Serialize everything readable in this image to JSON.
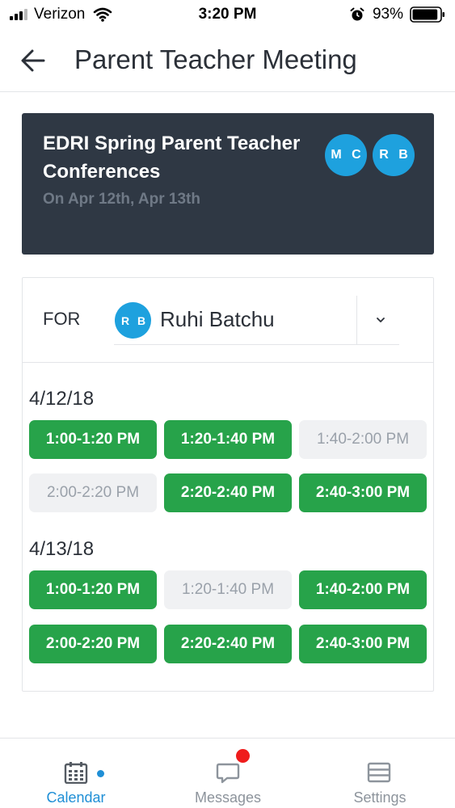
{
  "status_bar": {
    "carrier": "Verizon",
    "time": "3:20 PM",
    "battery": "93%",
    "battery_level": 0.93
  },
  "header": {
    "title": "Parent Teacher Meeting",
    "back_icon": "back-arrow-icon"
  },
  "event": {
    "title": "EDRI Spring Parent Teacher Conferences",
    "dates": "On Apr 12th, Apr 13th",
    "participants": [
      "M C",
      "R B"
    ],
    "colors": {
      "card_bg": "#2f3844",
      "avatar": "#1ea1de"
    }
  },
  "booking": {
    "for_label": "FOR",
    "student": {
      "initials": "R B",
      "name": "Ruhi Batchu"
    },
    "days": [
      {
        "date": "4/12/18",
        "slots": [
          {
            "time": "1:00-1:20 PM",
            "available": true
          },
          {
            "time": "1:20-1:40 PM",
            "available": true
          },
          {
            "time": "1:40-2:00 PM",
            "available": false
          },
          {
            "time": "2:00-2:20 PM",
            "available": false
          },
          {
            "time": "2:20-2:40 PM",
            "available": true
          },
          {
            "time": "2:40-3:00 PM",
            "available": true
          }
        ]
      },
      {
        "date": "4/13/18",
        "slots": [
          {
            "time": "1:00-1:20 PM",
            "available": true
          },
          {
            "time": "1:20-1:40 PM",
            "available": false
          },
          {
            "time": "1:40-2:00 PM",
            "available": true
          },
          {
            "time": "2:00-2:20 PM",
            "available": true
          },
          {
            "time": "2:20-2:40 PM",
            "available": true
          },
          {
            "time": "2:40-3:00 PM",
            "available": true
          }
        ]
      }
    ],
    "colors": {
      "available": "#27a34a",
      "unavailable": "#f0f1f3"
    }
  },
  "tabs": [
    {
      "label": "Calendar",
      "icon": "calendar-icon",
      "active": true
    },
    {
      "label": "Messages",
      "icon": "chat-bubble-icon",
      "active": false,
      "has_notification": true
    },
    {
      "label": "Settings",
      "icon": "settings-list-icon",
      "active": false
    }
  ],
  "colors": {
    "accent": "#1f8fd6",
    "notification": "#ef1c1c"
  }
}
